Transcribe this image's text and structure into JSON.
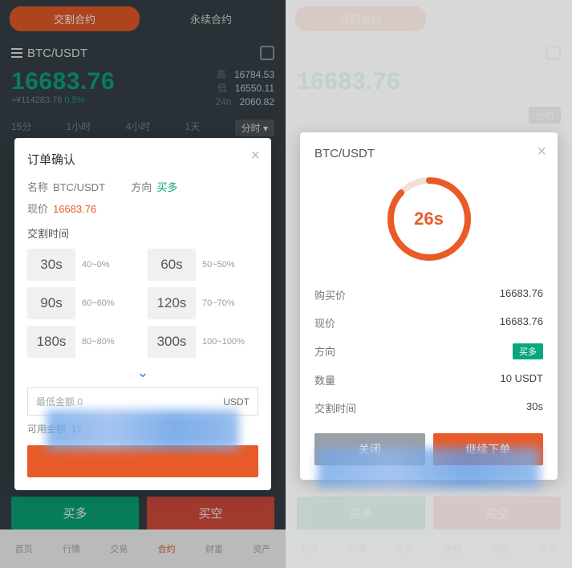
{
  "left": {
    "tabs": {
      "delivery": "交割合约",
      "perpetual": "永续合约"
    },
    "pair": "BTC/USDT",
    "price": "16683.76",
    "priceCny": "≈¥114283.76",
    "pct": "0.5%",
    "stats": {
      "high_lbl": "高",
      "high": "16784.53",
      "low_lbl": "低",
      "low": "16550.11",
      "vol_lbl": "24h",
      "vol": "2060.82"
    },
    "tf": {
      "t1": "15分",
      "t2": "1小时",
      "t3": "4小时",
      "t4": "1天",
      "t5": "分时"
    },
    "modal": {
      "title": "订单确认",
      "name_lbl": "名称",
      "name": "BTC/USDT",
      "dir_lbl": "方向",
      "dir": "买多",
      "now_lbl": "现价",
      "now": "16683.76",
      "delivery_lbl": "交割时间",
      "times": [
        {
          "v": "30s",
          "p": "40~0%"
        },
        {
          "v": "60s",
          "p": "50~50%"
        },
        {
          "v": "90s",
          "p": "60~60%"
        },
        {
          "v": "120s",
          "p": "70~70%"
        },
        {
          "v": "180s",
          "p": "80~80%"
        },
        {
          "v": "300s",
          "p": "100~100%"
        }
      ],
      "amount_ph": "最低金额 0",
      "unit": "USDT",
      "avail_lbl": "可用金额",
      "avail": "17"
    },
    "buy": "买多",
    "sell": "买空",
    "nav": {
      "n1": "首页",
      "n2": "行情",
      "n3": "交易",
      "n4": "合约",
      "n5": "财富",
      "n6": "资产"
    }
  },
  "right": {
    "modal": {
      "title": "BTC/USDT",
      "timer": "26s",
      "rows": {
        "buyprice_lbl": "购买价",
        "buyprice": "16683.76",
        "now_lbl": "现价",
        "now": "16683.76",
        "dir_lbl": "方向",
        "dir": "买多",
        "qty_lbl": "数量",
        "qty": "10 USDT",
        "deliv_lbl": "交割时间",
        "deliv": "30s"
      },
      "btn_close": "关闭",
      "btn_continue": "继续下单"
    }
  }
}
